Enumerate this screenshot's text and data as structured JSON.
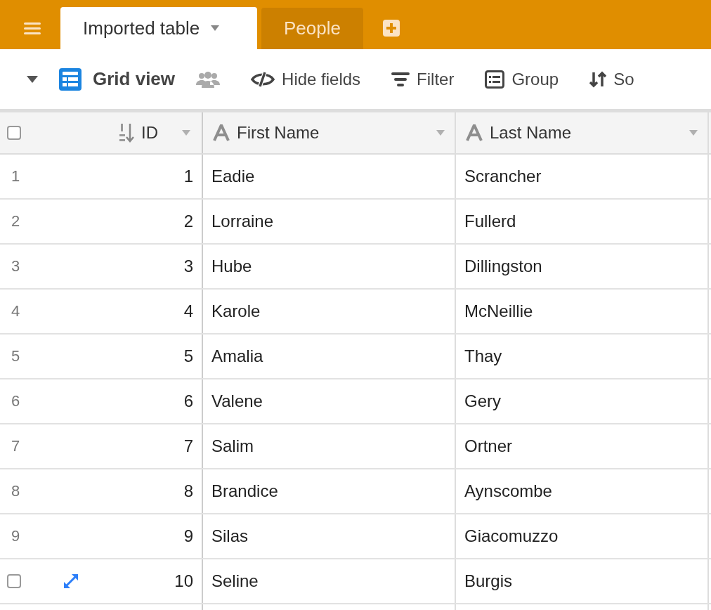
{
  "tabs": [
    {
      "label": "Imported table",
      "selected": true
    },
    {
      "label": "People",
      "selected": false
    }
  ],
  "view": {
    "name": "Grid view"
  },
  "toolbar": [
    {
      "kind": "hide",
      "label": "Hide fields"
    },
    {
      "kind": "filter",
      "label": "Filter"
    },
    {
      "kind": "group",
      "label": "Group"
    },
    {
      "kind": "sort",
      "label": "So"
    }
  ],
  "table": {
    "select_all": {
      "checked": false
    },
    "columns": [
      {
        "kind": "number",
        "label": "ID"
      },
      {
        "kind": "text",
        "label": "First Name"
      },
      {
        "kind": "text",
        "label": "Last Name"
      }
    ],
    "rows": [
      {
        "number": "1",
        "hovered": false,
        "cells": [
          "1",
          "Eadie",
          "Scrancher"
        ]
      },
      {
        "number": "2",
        "hovered": false,
        "cells": [
          "2",
          "Lorraine",
          "Fullerd"
        ]
      },
      {
        "number": "3",
        "hovered": false,
        "cells": [
          "3",
          "Hube",
          "Dillingston"
        ]
      },
      {
        "number": "4",
        "hovered": false,
        "cells": [
          "4",
          "Karole",
          "McNeillie"
        ]
      },
      {
        "number": "5",
        "hovered": false,
        "cells": [
          "5",
          "Amalia",
          "Thay"
        ]
      },
      {
        "number": "6",
        "hovered": false,
        "cells": [
          "6",
          "Valene",
          "Gery"
        ]
      },
      {
        "number": "7",
        "hovered": false,
        "cells": [
          "7",
          "Salim",
          "Ortner"
        ]
      },
      {
        "number": "8",
        "hovered": false,
        "cells": [
          "8",
          "Brandice",
          "Aynscombe"
        ]
      },
      {
        "number": "9",
        "hovered": false,
        "cells": [
          "9",
          "Silas",
          "Giacomuzzo"
        ]
      },
      {
        "hovered": true,
        "checked": false,
        "cells": [
          "10",
          "Seline",
          "Burgis"
        ]
      }
    ]
  }
}
